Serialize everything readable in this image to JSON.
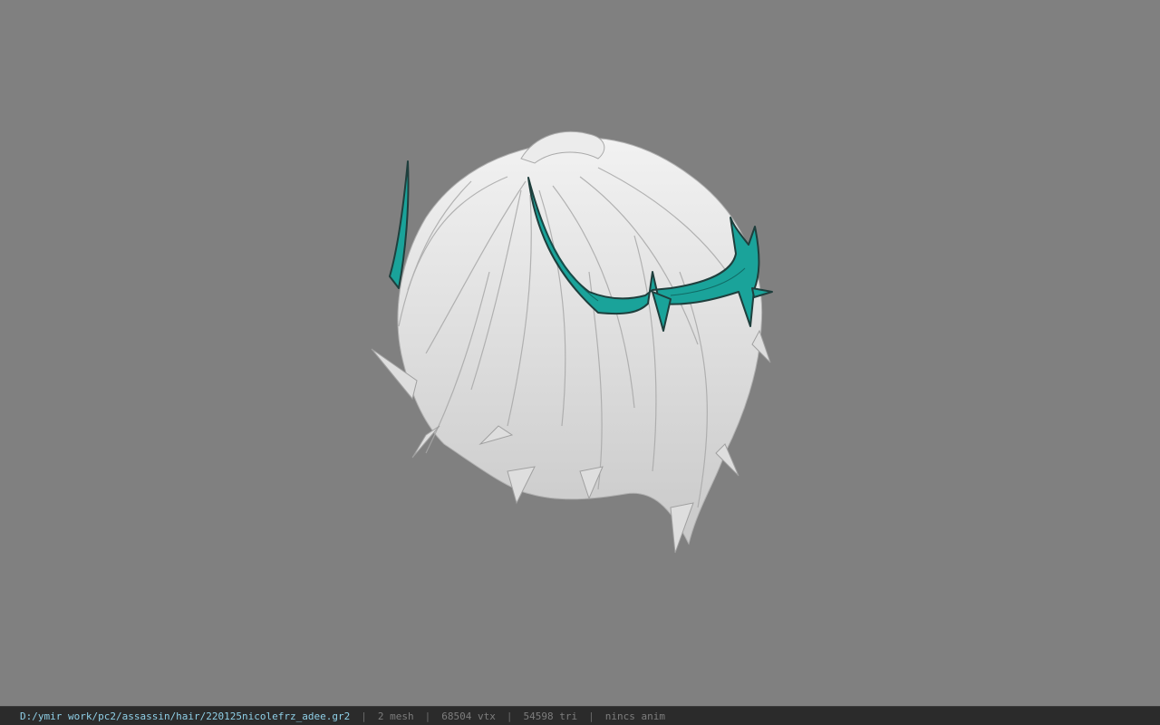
{
  "viewport": {
    "model_name": "3d-hair-model",
    "accent_color": "#1aa39a",
    "hair_color": "#e8e8e8",
    "background_color": "#808080"
  },
  "statusbar": {
    "file_path": "D:/ymir work/pc2/assassin/hair/220125nicolefrz_adee.gr2",
    "separator": "|",
    "mesh_count": "2 mesh",
    "vertex_count": "68504 vtx",
    "triangle_count": "54598 tri",
    "anim_status": "nincs anim"
  }
}
